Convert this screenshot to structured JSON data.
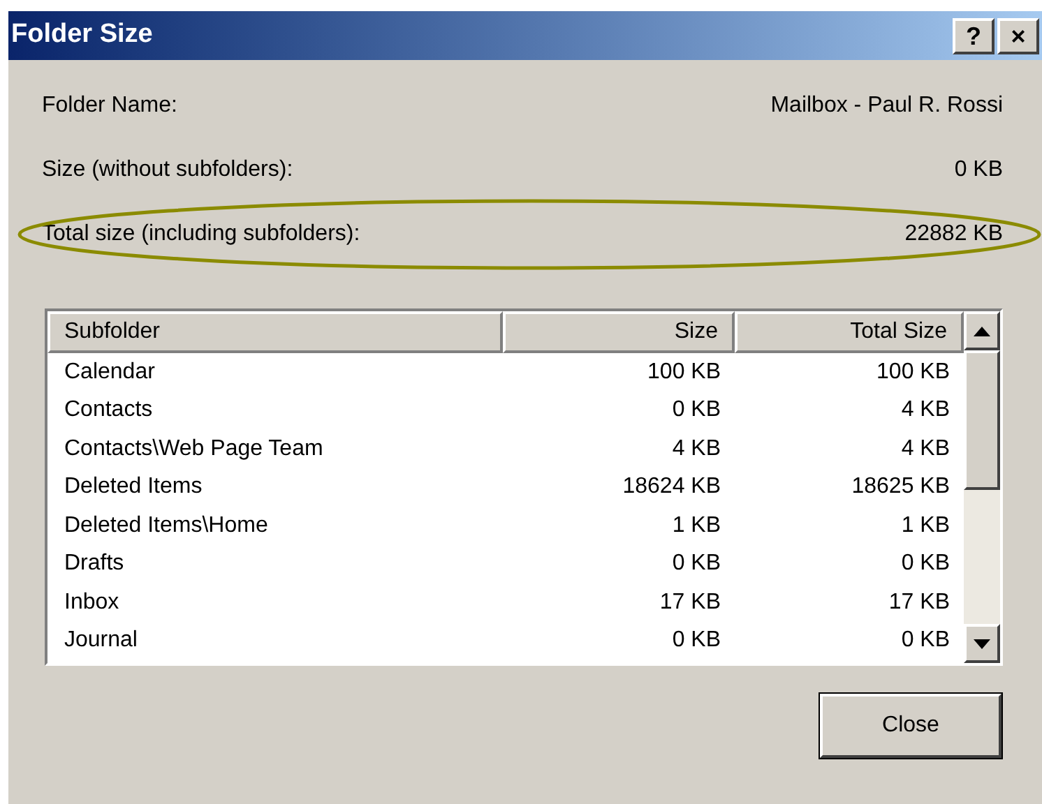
{
  "window": {
    "title": "Folder Size",
    "buttons": [
      "?",
      "×"
    ]
  },
  "info_rows": [
    {
      "label": "Folder Name:",
      "value": "Mailbox - Paul R. Rossi",
      "highlighted": false
    },
    {
      "label": "Size (without subfolders):",
      "value": "0 KB",
      "highlighted": false
    },
    {
      "label": "Total size (including subfolders):",
      "value": "22882 KB",
      "highlighted": true
    }
  ],
  "table": {
    "columns": [
      "Subfolder",
      "Size",
      "Total Size"
    ],
    "rows": [
      [
        "Calendar",
        "100 KB",
        "100 KB"
      ],
      [
        "Contacts",
        "0 KB",
        "4 KB"
      ],
      [
        "Contacts\\Web Page Team",
        "4 KB",
        "4 KB"
      ],
      [
        "Deleted Items",
        "18624 KB",
        "18625 KB"
      ],
      [
        "Deleted Items\\Home",
        "1 KB",
        "1 KB"
      ],
      [
        "Drafts",
        "0 KB",
        "0 KB"
      ],
      [
        "Inbox",
        "17 KB",
        "17 KB"
      ],
      [
        "Journal",
        "0 KB",
        "0 KB"
      ]
    ]
  },
  "buttons": [
    "Close"
  ]
}
